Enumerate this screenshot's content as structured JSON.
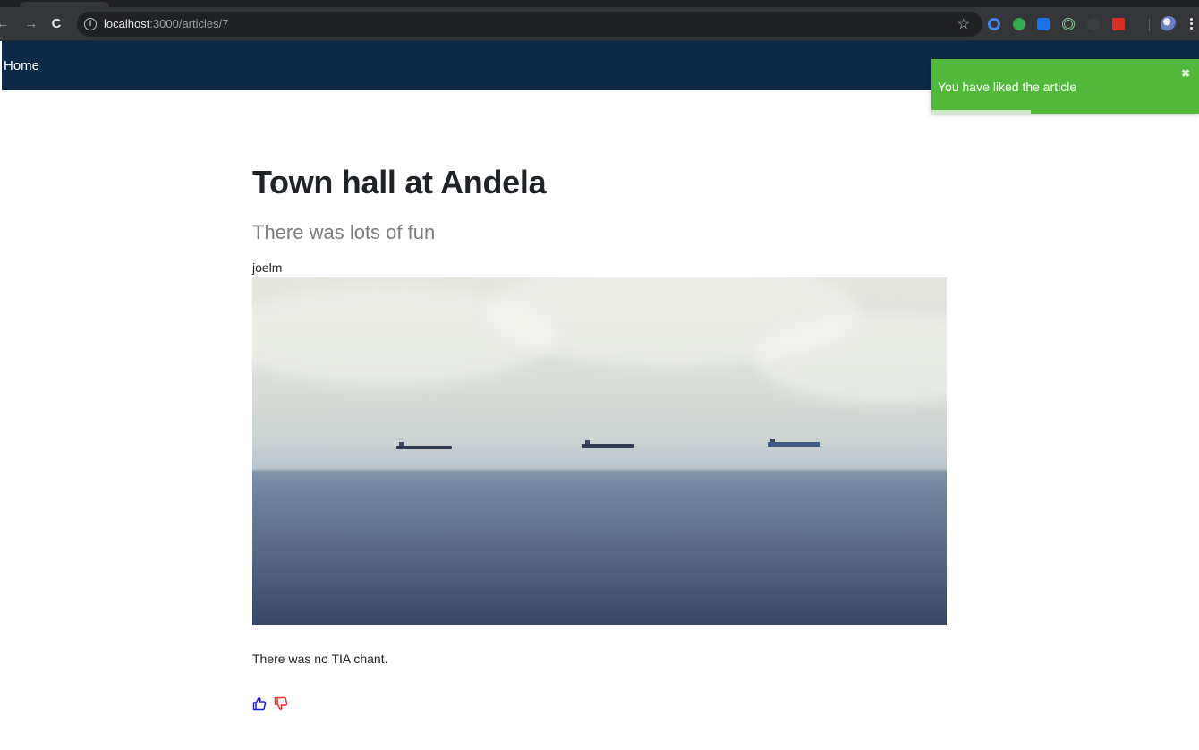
{
  "browser": {
    "url_host": "localhost",
    "url_path": ":3000/articles/7",
    "extension_colors": [
      "#4285f4",
      "#34a853",
      "#1a73e8",
      "#81c995",
      "#5f6368",
      "#d93025"
    ]
  },
  "navbar": {
    "home_label": "Home"
  },
  "toast": {
    "message": "You have liked the article",
    "close_symbol": "✖",
    "color": "#51b83a",
    "progress_fraction": 0.37
  },
  "article": {
    "title": "Town hall at Andela",
    "subtitle": "There was lots of fun",
    "author": "joelm",
    "body": "There was no TIA chant.",
    "like_color": "#1a1aff",
    "dislike_color": "#ff2a2a"
  }
}
